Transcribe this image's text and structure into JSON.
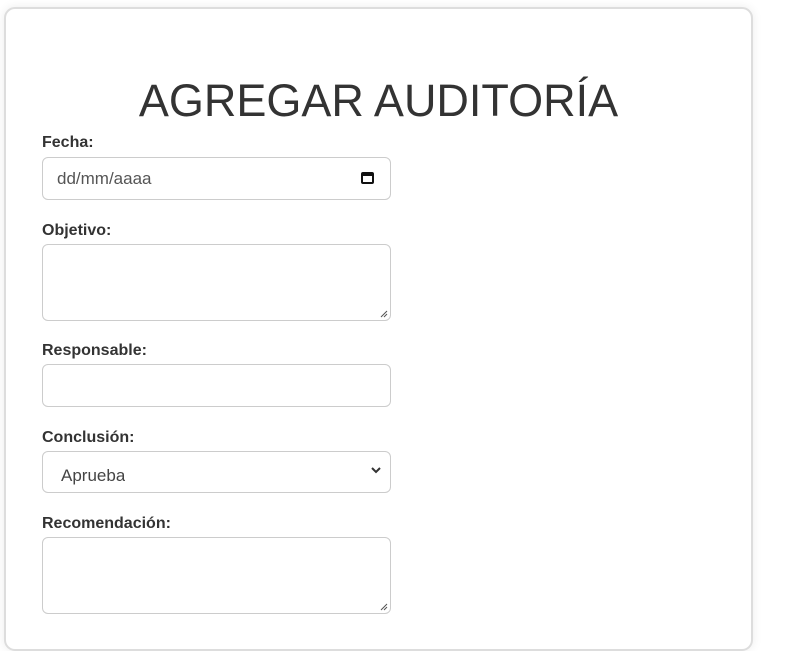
{
  "title": "AGREGAR AUDITORÍA",
  "fields": {
    "fecha": {
      "label": "Fecha:",
      "placeholder": "dd/mm/aaaa"
    },
    "objetivo": {
      "label": "Objetivo:",
      "value": ""
    },
    "responsable": {
      "label": "Responsable:",
      "value": ""
    },
    "conclusion": {
      "label": "Conclusión:",
      "selected": "Aprueba"
    },
    "recomendacion": {
      "label": "Recomendación:",
      "value": ""
    }
  }
}
